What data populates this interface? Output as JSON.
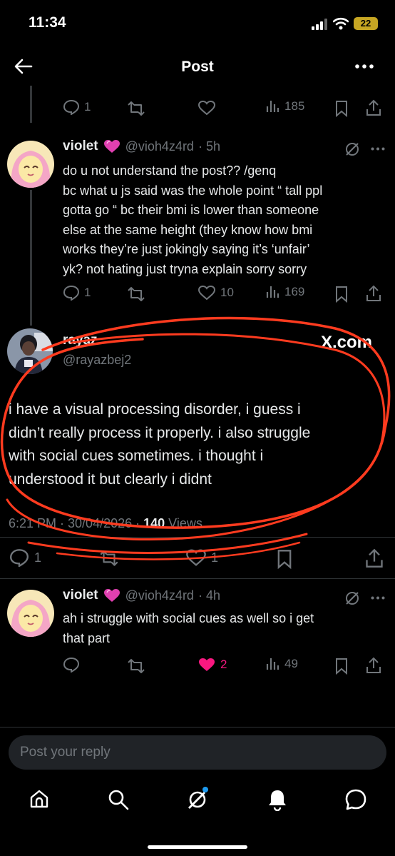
{
  "status": {
    "time": "11:34",
    "battery": "22"
  },
  "header": {
    "title": "Post"
  },
  "tweets": [
    {
      "actions": {
        "reply": "1",
        "like": "",
        "views": "185"
      }
    },
    {
      "name": "violet",
      "handle": "@vioh4z4rd",
      "time": "· 5h",
      "text": [
        "do u not understand the post?? /genq",
        "bc what u js said was the whole point “ tall ppl",
        "gotta go “ bc their bmi is lower than someone",
        "else at the same height (they know how bmi",
        "works they’re just jokingly saying it’s ‘unfair’",
        "yk? not hating just tryna explain sorry sorry"
      ],
      "actions": {
        "reply": "1",
        "like": "10",
        "views": "169"
      }
    },
    {
      "name": "rayaz",
      "handle": "@rayazbej2",
      "badge": "X.com",
      "text": [
        "i have a visual processing disorder, i guess i",
        "didn’t really process it properly. i also struggle",
        "with social cues sometimes. i thought i",
        "understood it but clearly i didnt"
      ],
      "meta_time": "6:21 PM · 30/04/2026 · ",
      "meta_views": "140",
      "meta_views_label": " Views",
      "actions": {
        "reply": "1",
        "like": "1"
      }
    },
    {
      "name": "violet",
      "handle": "@vioh4z4rd",
      "time": "· 4h",
      "text": [
        "ah i struggle with social cues as well so i get",
        "that part"
      ],
      "actions": {
        "like": "2",
        "views": "49"
      }
    }
  ],
  "reply": {
    "placeholder": "Post your reply"
  },
  "colors": {
    "like_active": "#f91880",
    "annotation": "#ff3b1f",
    "battery": "#c7a623"
  }
}
